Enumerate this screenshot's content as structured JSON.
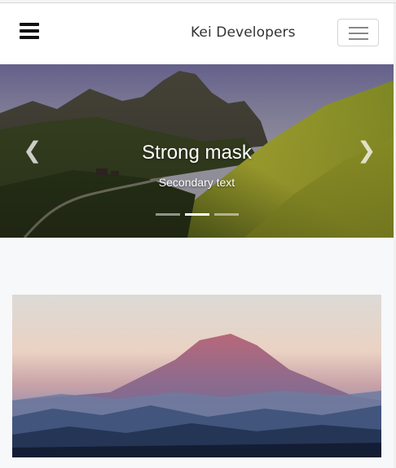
{
  "navbar": {
    "brand": "Kei Developers",
    "menu_icon": "hamburger-menu-icon",
    "toggler_icon": "navbar-toggler-icon"
  },
  "carousel": {
    "caption_title": "Strong mask",
    "caption_subtitle": "Secondary text",
    "prev_icon": "chevron-left-icon",
    "next_icon": "chevron-right-icon",
    "slide_count": 3,
    "active_slide": 2
  },
  "colors": {
    "navbar_bg": "#ffffff",
    "section_bg": "#f7f8fa",
    "indicator_active": "#ffffff"
  }
}
